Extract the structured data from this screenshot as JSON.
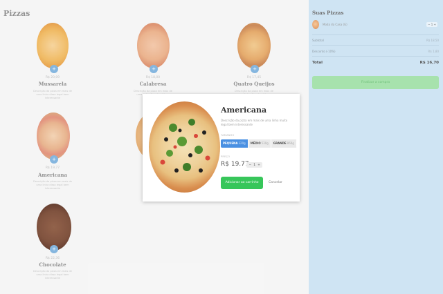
{
  "menu": {
    "title": "Pizzas",
    "items": [
      {
        "name": "Mussarela",
        "price": "R$ 20,09",
        "description": "Descrição da pizza em mais de uma linha disso legal bem interessante",
        "add": "+",
        "image": "pizza-mussarela"
      },
      {
        "name": "Calabresa",
        "price": "R$ 18,00",
        "description": "Descrição da pizza em mais de uma linha disso legal bem interessante",
        "add": "+",
        "image": "pizza-calabresa"
      },
      {
        "name": "Quatro Queijos",
        "price": "R$ 17,45",
        "description": "Descrição da pizza em mais de uma linha disso legal bem interessante",
        "add": "+",
        "image": "pizza-quatro-queijos"
      },
      {
        "name": "Americana",
        "price": "R$ 19,77",
        "description": "Descrição da pizza em mais de uma linha disso legal bem interessante",
        "add": "+",
        "image": "pizza-americana"
      },
      {
        "name": "Chocolate",
        "price": "R$ 22,36",
        "description": "Descrição da pizza em mais de uma linha disso legal bem interessante",
        "add": "+",
        "image": "pizza-chocolate"
      }
    ]
  },
  "modal": {
    "title": "Americana",
    "description": "Descrição da pizza em mais de uma linha muito legal bem interessante",
    "size_label": "TAMANHO",
    "sizes": [
      {
        "name": "PEQUENA",
        "grams": "320g",
        "selected": true
      },
      {
        "name": "MÉDIO",
        "grams": "530g",
        "selected": false
      },
      {
        "name": "GRANDE",
        "grams": "860g",
        "selected": false
      }
    ],
    "price_label": "PREÇO",
    "price": "R$ 19.77",
    "quantity": "1",
    "minus": "−",
    "plus": "+",
    "add_button": "Adicionar ao carrinho",
    "cancel": "Cancelar"
  },
  "cart": {
    "title": "Suas Pizzas",
    "item_name": "Moda da Casa (G)",
    "item_qty": "1",
    "subtotal_label": "Subtotal",
    "subtotal": "R$ 18,50",
    "discount_label": "Desconto (-10%)",
    "discount": "R$ 1,80",
    "total_label": "Total",
    "total": "R$ 16,70",
    "checkout": "Finalizar a compra"
  },
  "colors": {
    "accent_blue": "#4a90e2",
    "add_green": "#37c65a",
    "cart_bg": "#cfe4f3",
    "checkout_green": "#a7e2ad"
  }
}
